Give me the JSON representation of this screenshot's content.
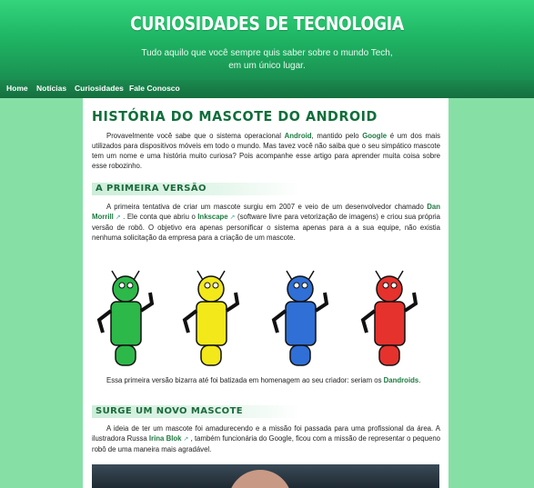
{
  "site": {
    "title": "CURIOSIDADES DE TECNOLOGIA",
    "tagline": "Tudo aquilo que você sempre quis saber sobre o mundo Tech, em um único lugar."
  },
  "nav": {
    "items": [
      "Home",
      "Notícias",
      "Curiosidades",
      "Fale Conosco"
    ]
  },
  "article": {
    "title": "HISTÓRIA DO MASCOTE DO ANDROID",
    "intro": {
      "t1": "Provavelmente você sabe que o sistema operacional ",
      "android": "Android",
      "t2": ", mantido pelo ",
      "google": "Google",
      "t3": " é um dos mais utilizados para dispositivos móveis em todo o mundo. Mas tavez você não saiba que o seu simpático mascote tem um nome e uma história muito curiosa? Pois acompanhe esse artigo para aprender muita coisa sobre esse robozinho."
    },
    "section1": {
      "heading": "A PRIMEIRA VERSÃO",
      "t1": "A primeira tentativa de criar um mascote surgiu em 2007 e veio de um desenvolvedor chamado ",
      "dan": "Dan Morrill",
      "t2": " . Ele conta que abriu o ",
      "inkscape": "Inkscape",
      "t3": " (software livre para vetorização de imagens) e criou sua própria versão de robô. O objetivo era apenas personificar o sistema apenas para a a sua equipe, não existia nenhuma solicitação da empresa para a criação de um mascote.",
      "after1": "Essa primeira versão bizarra até foi batizada em homenagem ao seu criador: seriam os ",
      "dandroids": "Dandroids",
      "after2": "."
    },
    "section2": {
      "heading": "SURGE UM NOVO MASCOTE",
      "t1": "A ideia de ter um mascote foi amadurecendo e a missão foi passada para uma profissional da área. A ilustradora Russa ",
      "irina": "Irina Blok",
      "t2": " , também funcionária do Google, ficou com a missão de representar o pequeno robô de uma maneira mais agradável."
    },
    "robot_colors": [
      "#2db84a",
      "#f2e81a",
      "#2f6fd6",
      "#e5322d"
    ],
    "link_icon": "external-link-icon"
  },
  "colors": {
    "accent": "#1c7a40",
    "background": "#86e0a6"
  }
}
